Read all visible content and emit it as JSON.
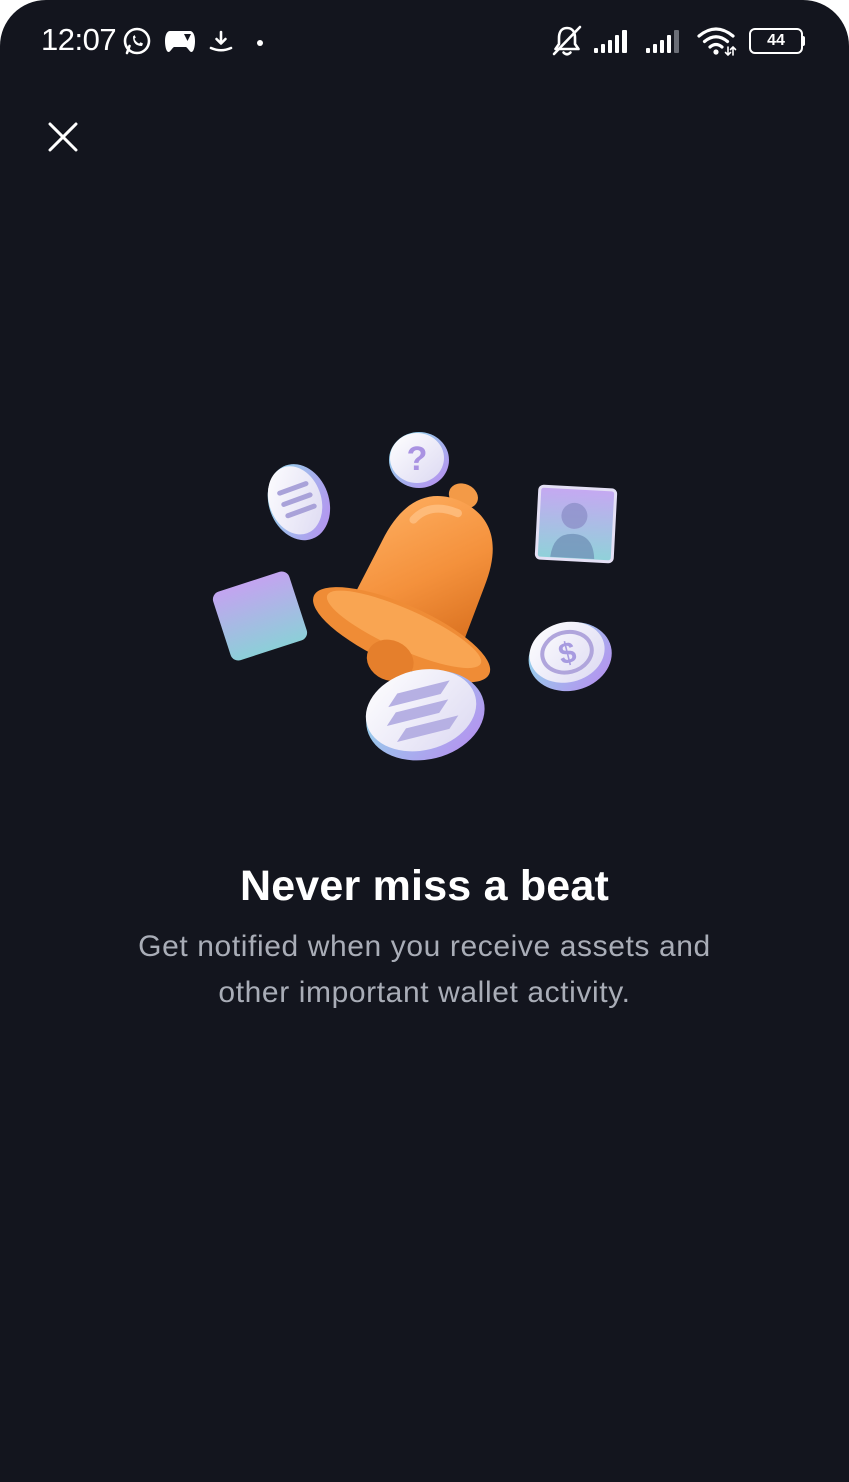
{
  "status_bar": {
    "time": "12:07",
    "battery_level": "44",
    "left_icons": [
      "whatsapp-icon",
      "game-controller-icon",
      "download-icon",
      "dot-icon"
    ],
    "right_icons": [
      "bell-muted-icon",
      "signal-icon",
      "signal-icon",
      "wifi-icon",
      "battery-icon"
    ]
  },
  "header": {
    "close_icon": "close-icon"
  },
  "illustration": {
    "elements": [
      "bell-icon",
      "question-badge-icon",
      "solana-coin-icon",
      "profile-card-icon",
      "usdc-coin-icon",
      "solana-coin-icon",
      "gradient-card-icon"
    ],
    "colors": {
      "bell": "#f4913c",
      "gradient_start": "#c3a4f0",
      "gradient_end": "#8ccfd8"
    }
  },
  "content": {
    "title": "Never miss a beat",
    "subtitle": "Get notified when you receive assets and other important wallet activity."
  },
  "theme": {
    "background": "#13151e",
    "title_color": "#ffffff",
    "subtitle_color": "#a9adb7"
  }
}
